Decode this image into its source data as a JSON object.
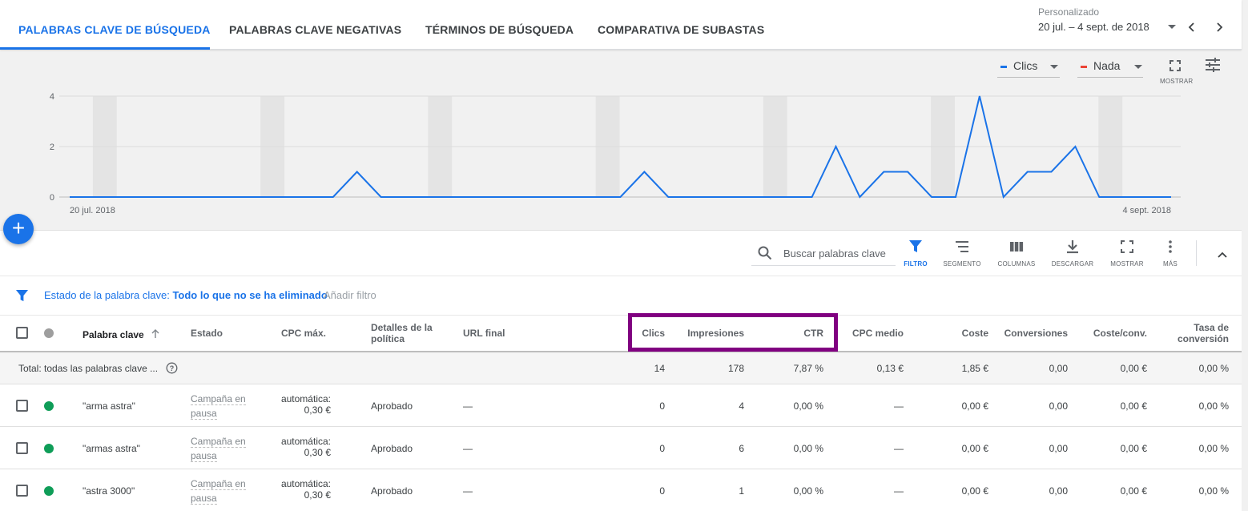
{
  "tabs": [
    {
      "label": "PALABRAS CLAVE DE BÚSQUEDA",
      "active": true
    },
    {
      "label": "PALABRAS CLAVE NEGATIVAS",
      "active": false
    },
    {
      "label": "TÉRMINOS DE BÚSQUEDA",
      "active": false
    },
    {
      "label": "COMPARATIVA DE SUBASTAS",
      "active": false
    }
  ],
  "date_range": {
    "caption": "Personalizado",
    "value": "20 jul. – 4 sept. de 2018"
  },
  "chart_controls": {
    "metric1": {
      "label": "Clics",
      "color": "#1a73e8"
    },
    "metric2": {
      "label": "Nada",
      "color": "#ea4335"
    },
    "expand_label": "MOSTRAR"
  },
  "chart_data": {
    "type": "line",
    "x_start_label": "20 jul. 2018",
    "x_end_label": "4 sept. 2018",
    "ylim": [
      0,
      4
    ],
    "yticks": [
      "0",
      "2",
      "4"
    ],
    "grid": true,
    "series": [
      {
        "values": [
          0,
          0,
          0,
          0,
          0,
          0,
          0,
          0,
          0,
          0,
          0,
          0,
          1,
          0,
          0,
          0,
          0,
          0,
          0,
          0,
          0,
          0,
          0,
          0,
          1,
          0,
          0,
          0,
          0,
          0,
          0,
          0,
          2,
          0,
          1,
          1,
          0,
          0,
          4,
          0,
          1,
          1,
          2,
          0,
          0,
          0,
          0
        ]
      }
    ],
    "color": "#1a73e8"
  },
  "add_button": "+",
  "toolbar": {
    "search_placeholder": "Buscar palabras clave",
    "buttons": [
      "FILTRO",
      "SEGMENTO",
      "COLUMNAS",
      "DESCARGAR",
      "MOSTRAR",
      "MÁS"
    ]
  },
  "filter": {
    "label": "Estado de la palabra clave:",
    "value": "Todo lo que no se ha eliminado",
    "add": "Añadir filtro"
  },
  "table": {
    "headers": {
      "keyword": "Palabra clave",
      "status": "Estado",
      "max_cpc": "CPC máx.",
      "policy_1": "Detalles de la",
      "policy_2": "política",
      "final_url": "URL final",
      "clicks": "Clics",
      "impressions": "Impresiones",
      "ctr": "CTR",
      "avg_cpc": "CPC medio",
      "cost": "Coste",
      "conversions": "Conversiones",
      "cost_conv": "Coste/conv.",
      "conv_rate_1": "Tasa de",
      "conv_rate_2": "conversión"
    },
    "total": {
      "label": "Total: todas las palabras clave ...",
      "clicks": "14",
      "impressions": "178",
      "ctr": "7,87 %",
      "avg_cpc": "0,13 €",
      "cost": "1,85 €",
      "conversions": "0,00",
      "cost_conv": "0,00 €",
      "conv_rate": "0,00 %"
    },
    "rows": [
      {
        "keyword": "\"arma astra\"",
        "status_1": "Campaña en",
        "status_2": "pausa",
        "cpc_1": "automática:",
        "cpc_2": "0,30 €",
        "policy": "Aprobado",
        "url": "—",
        "clicks": "0",
        "impressions": "4",
        "ctr": "0,00 %",
        "avg_cpc": "—",
        "cost": "0,00 €",
        "conversions": "0,00",
        "cost_conv": "0,00 €",
        "conv_rate": "0,00 %"
      },
      {
        "keyword": "\"armas astra\"",
        "status_1": "Campaña en",
        "status_2": "pausa",
        "cpc_1": "automática:",
        "cpc_2": "0,30 €",
        "policy": "Aprobado",
        "url": "—",
        "clicks": "0",
        "impressions": "6",
        "ctr": "0,00 %",
        "avg_cpc": "—",
        "cost": "0,00 €",
        "conversions": "0,00",
        "cost_conv": "0,00 €",
        "conv_rate": "0,00 %"
      },
      {
        "keyword": "\"astra 3000\"",
        "status_1": "Campaña en",
        "status_2": "pausa",
        "cpc_1": "automática:",
        "cpc_2": "0,30 €",
        "policy": "Aprobado",
        "url": "—",
        "clicks": "0",
        "impressions": "1",
        "ctr": "0,00 %",
        "avg_cpc": "—",
        "cost": "0,00 €",
        "conversions": "0,00",
        "cost_conv": "0,00 €",
        "conv_rate": "0,00 %"
      }
    ]
  },
  "colors": {
    "accent": "#1a73e8",
    "enabled": "#0f9d58",
    "highlight": "#800080"
  }
}
